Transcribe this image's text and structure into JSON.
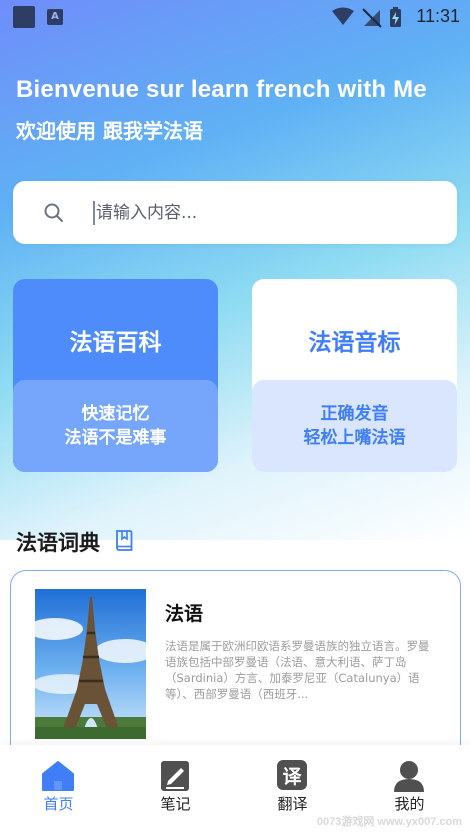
{
  "status_bar": {
    "time": "11:31",
    "app_badge": "A",
    "icons": [
      "app-icon",
      "a-badge-icon",
      "wifi-icon",
      "no-signal-icon",
      "battery-charging-icon"
    ]
  },
  "hero": {
    "title": "Bienvenue sur learn french with Me",
    "subtitle": "欢迎使用 跟我学法语"
  },
  "search": {
    "placeholder": "请输入内容...",
    "value": ""
  },
  "cards": [
    {
      "title": "法语百科",
      "line1": "快速记忆",
      "line2": "法语不是难事"
    },
    {
      "title": "法语音标",
      "line1": "正确发音",
      "line2": "轻松上嘴法语"
    }
  ],
  "dictionary": {
    "section_title": "法语词典",
    "item": {
      "title": "法语",
      "description": "法语是属于欧洲印欧语系罗曼语族的独立语言。罗曼语族包括中部罗曼语（法语、意大利语、萨丁岛（Sardinia）方言、加泰罗尼亚（Catalunya）语等）、西部罗曼语（西班牙..."
    }
  },
  "tabbar": {
    "items": [
      {
        "label": "首页",
        "icon": "home-icon",
        "active": true
      },
      {
        "label": "笔记",
        "icon": "notes-icon",
        "active": false
      },
      {
        "label": "翻译",
        "icon": "translate-icon",
        "glyph": "译",
        "active": false
      },
      {
        "label": "我的",
        "icon": "profile-icon",
        "active": false
      }
    ]
  },
  "watermark": "0073游戏网 www.yx007.com",
  "colors": {
    "accent": "#3f7ef6",
    "card_blue": "#4e8cfb",
    "card_light": "#d9e6fd"
  }
}
